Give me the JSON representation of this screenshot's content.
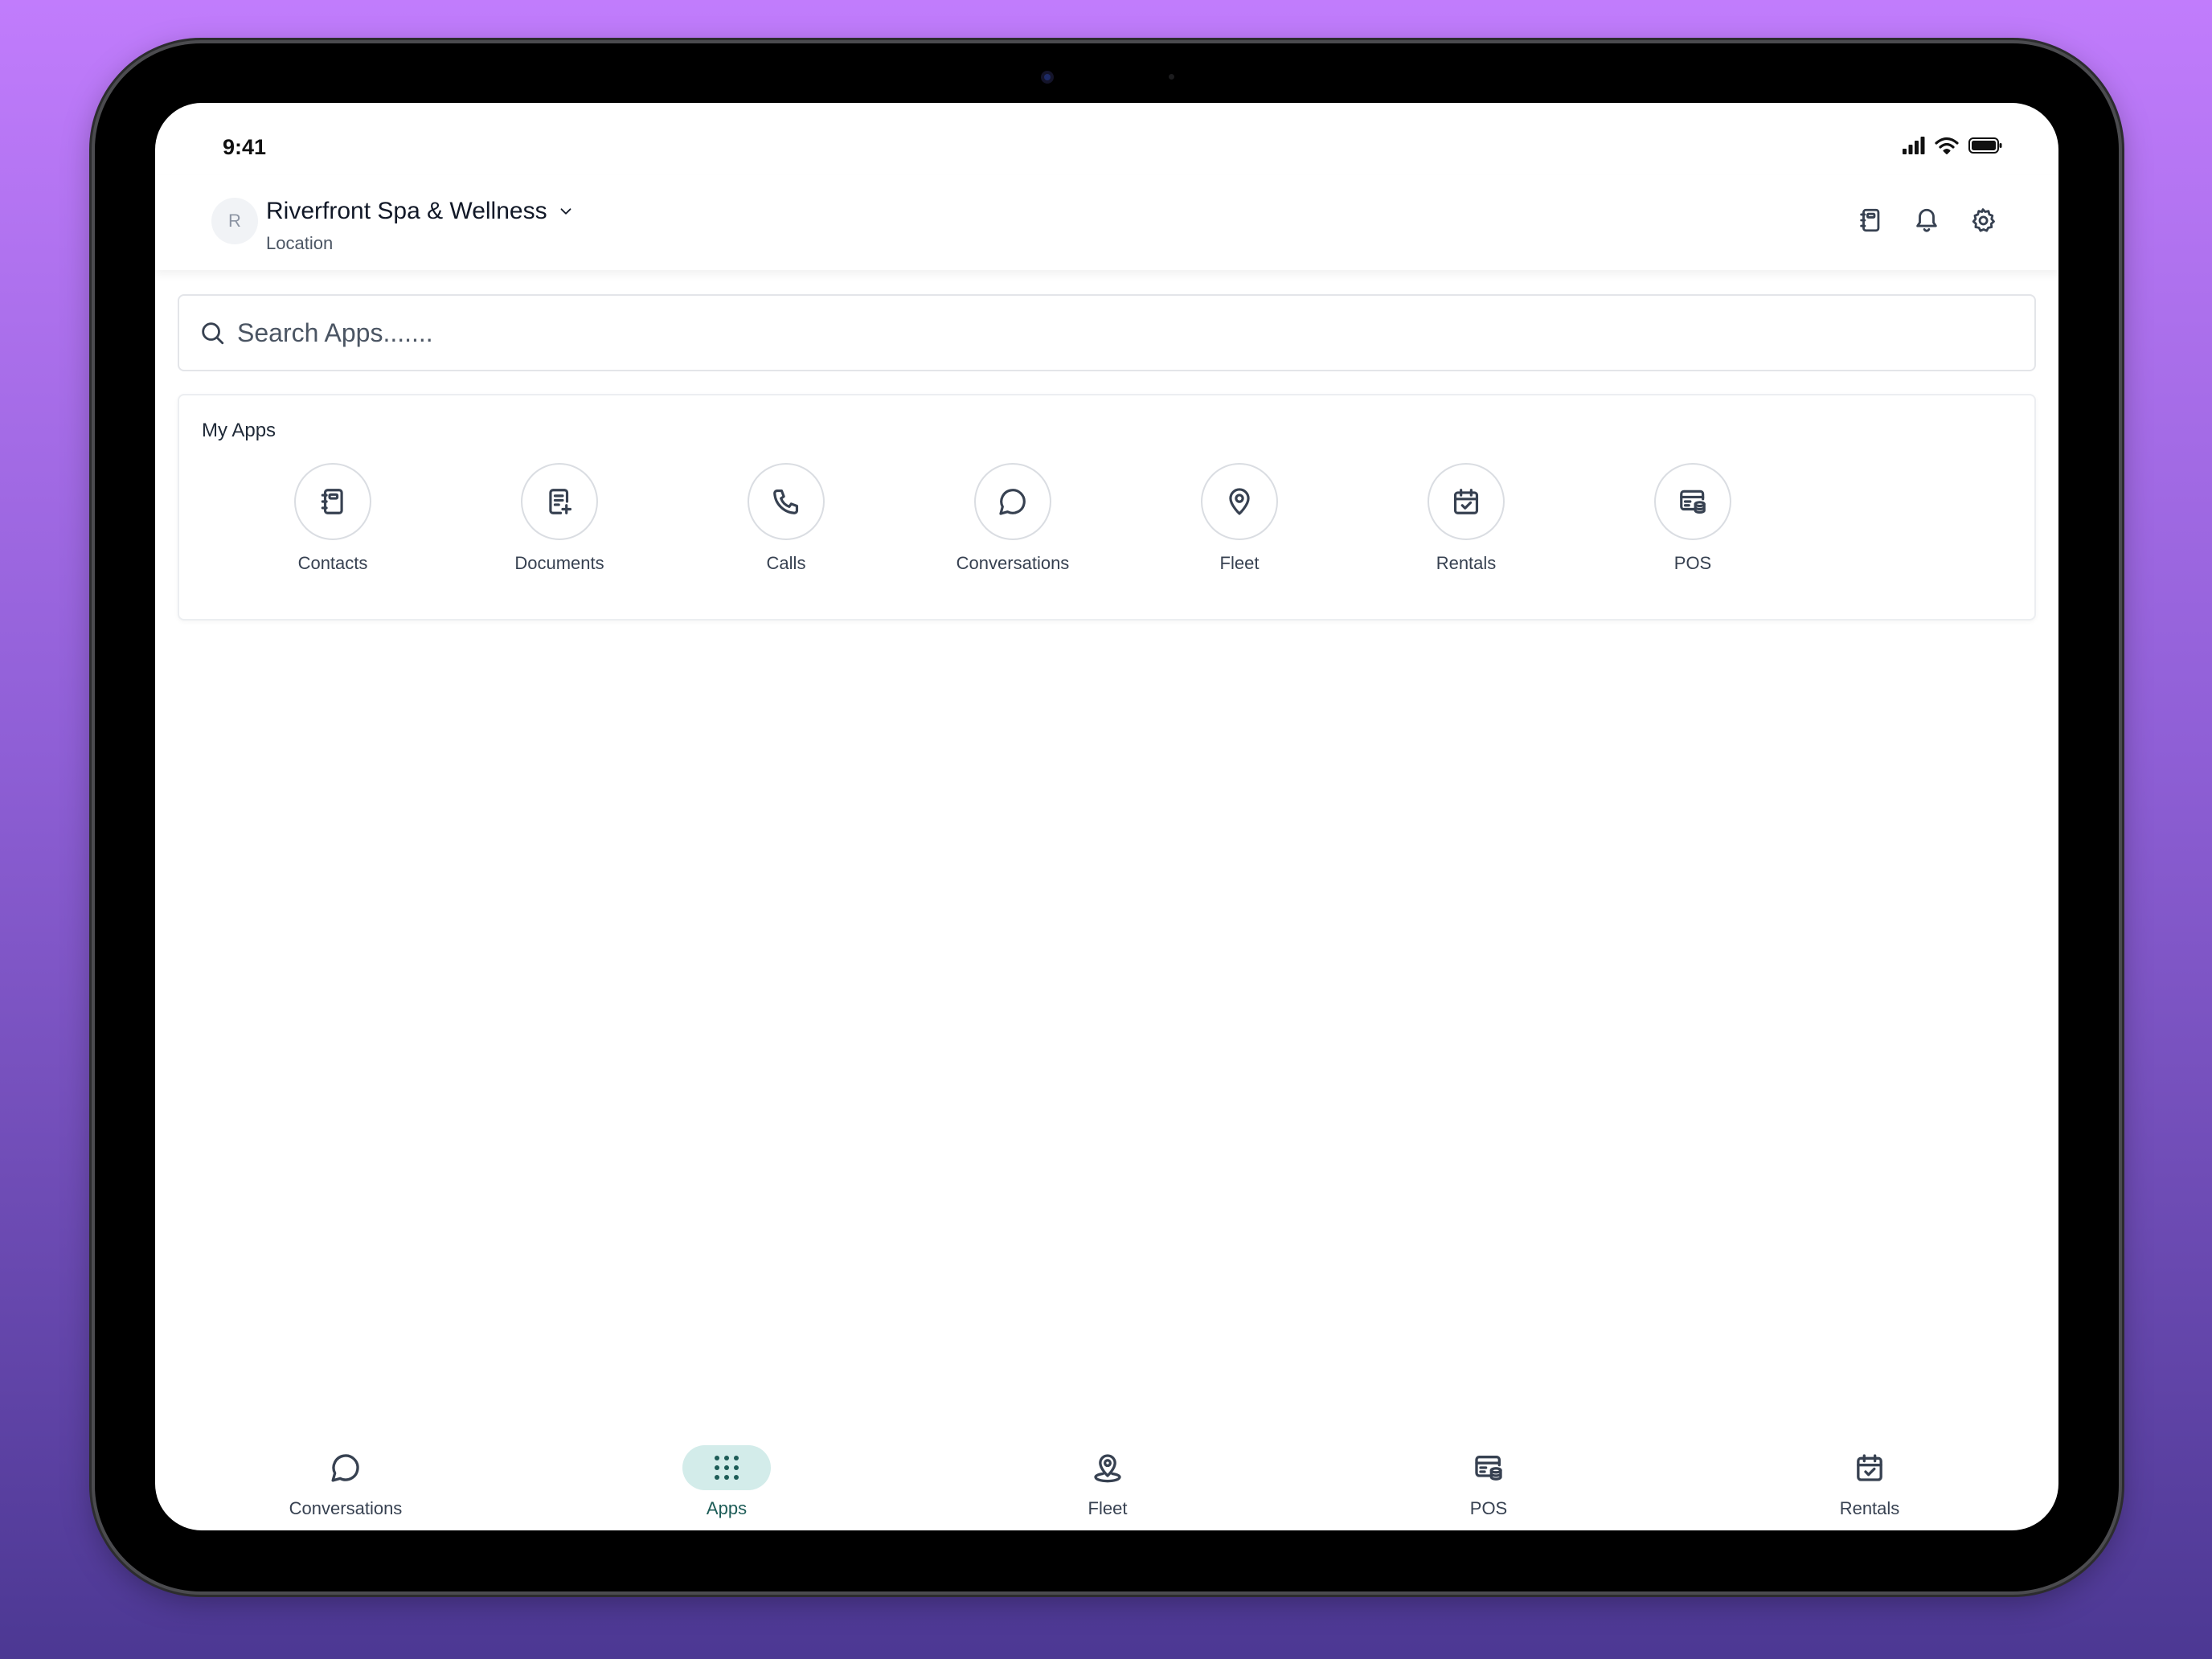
{
  "status_bar": {
    "time": "9:41"
  },
  "header": {
    "avatar_initial": "R",
    "location_name": "Riverfront Spa & Wellness",
    "location_label": "Location",
    "actions": [
      "contacts-book-icon",
      "bell-icon",
      "gear-icon"
    ]
  },
  "search": {
    "placeholder": "Search Apps......."
  },
  "my_apps": {
    "title": "My Apps",
    "items": [
      {
        "label": "Contacts",
        "icon": "contacts-book-icon"
      },
      {
        "label": "Documents",
        "icon": "document-add-icon"
      },
      {
        "label": "Calls",
        "icon": "phone-icon"
      },
      {
        "label": "Conversations",
        "icon": "chat-bubble-icon"
      },
      {
        "label": "Fleet",
        "icon": "map-pin-icon"
      },
      {
        "label": "Rentals",
        "icon": "calendar-check-icon"
      },
      {
        "label": "POS",
        "icon": "pos-register-icon"
      }
    ]
  },
  "bottom_nav": {
    "active": "Apps",
    "items": [
      {
        "label": "Conversations",
        "icon": "chat-bubble-icon"
      },
      {
        "label": "Apps",
        "icon": "grid-dots-icon"
      },
      {
        "label": "Fleet",
        "icon": "location-pin-icon"
      },
      {
        "label": "POS",
        "icon": "pos-register-icon"
      },
      {
        "label": "Rentals",
        "icon": "calendar-check-icon"
      }
    ]
  },
  "colors": {
    "background_top": "#c17cfc",
    "background_bottom": "#4c3893",
    "accent": "#1d5c57",
    "accent_bg": "#d3ecea",
    "text_primary": "#111827",
    "text_secondary": "#374151"
  }
}
